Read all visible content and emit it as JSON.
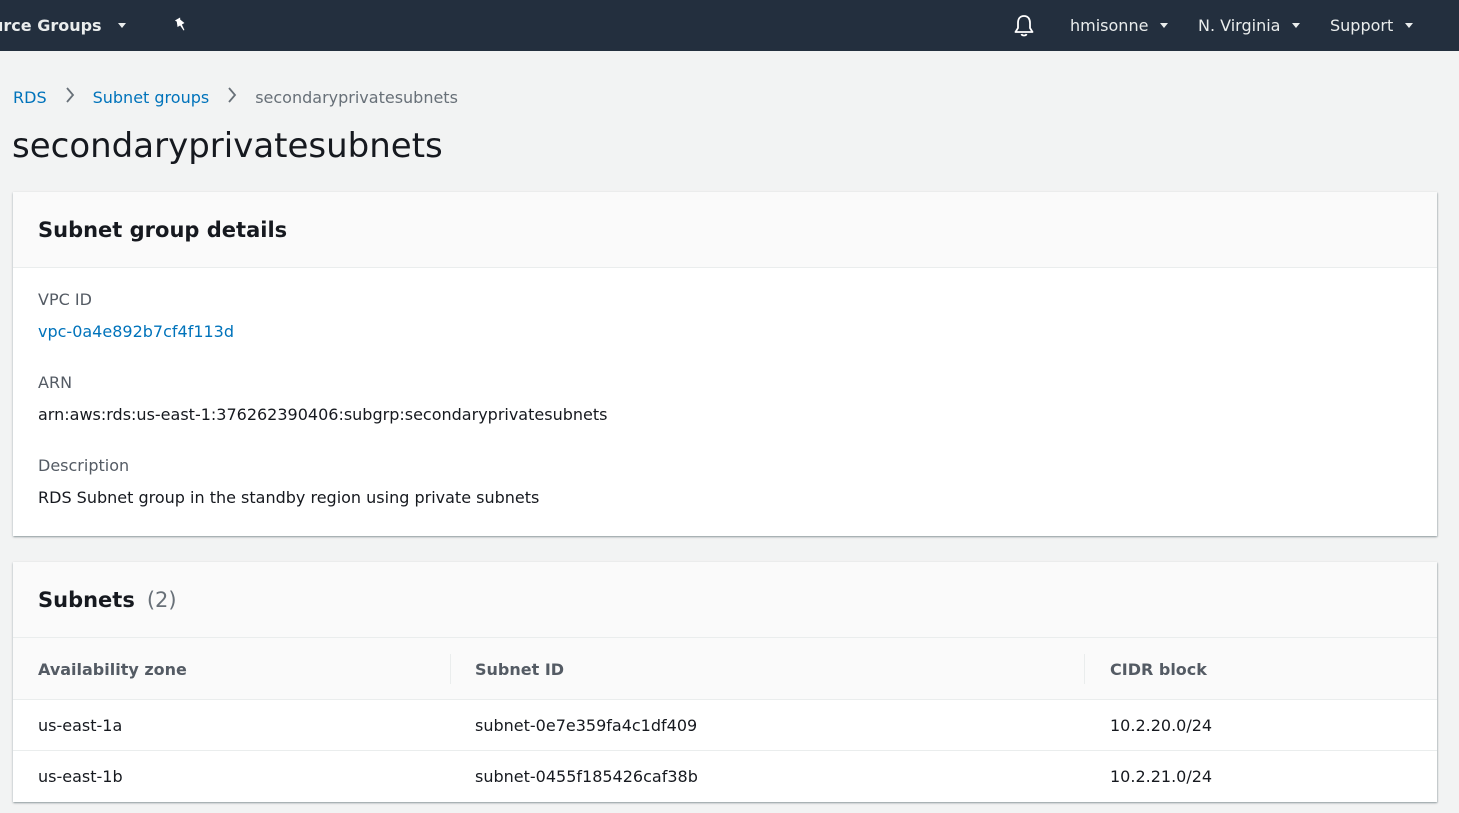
{
  "topnav": {
    "resource_groups": "urce Groups",
    "user": "hmisonne",
    "region": "N. Virginia",
    "support": "Support"
  },
  "breadcrumb": {
    "items": [
      "RDS",
      "Subnet groups",
      "secondaryprivatesubnets"
    ]
  },
  "page_title": "secondaryprivatesubnets",
  "details": {
    "title": "Subnet group details",
    "vpc_label": "VPC ID",
    "vpc_value": "vpc-0a4e892b7cf4f113d",
    "arn_label": "ARN",
    "arn_value": "arn:aws:rds:us-east-1:376262390406:subgrp:secondaryprivatesubnets",
    "description_label": "Description",
    "description_value": "RDS Subnet group in the standby region using private subnets"
  },
  "subnets": {
    "title": "Subnets",
    "count": "(2)",
    "columns": [
      "Availability zone",
      "Subnet ID",
      "CIDR block"
    ],
    "rows": [
      {
        "az": "us-east-1a",
        "subnet_id": "subnet-0e7e359fa4c1df409",
        "cidr": "10.2.20.0/24"
      },
      {
        "az": "us-east-1b",
        "subnet_id": "subnet-0455f185426caf38b",
        "cidr": "10.2.21.0/24"
      }
    ]
  },
  "colors": {
    "nav_bg": "#232f3e",
    "link": "#0073bb",
    "page_bg": "#f2f3f3"
  }
}
